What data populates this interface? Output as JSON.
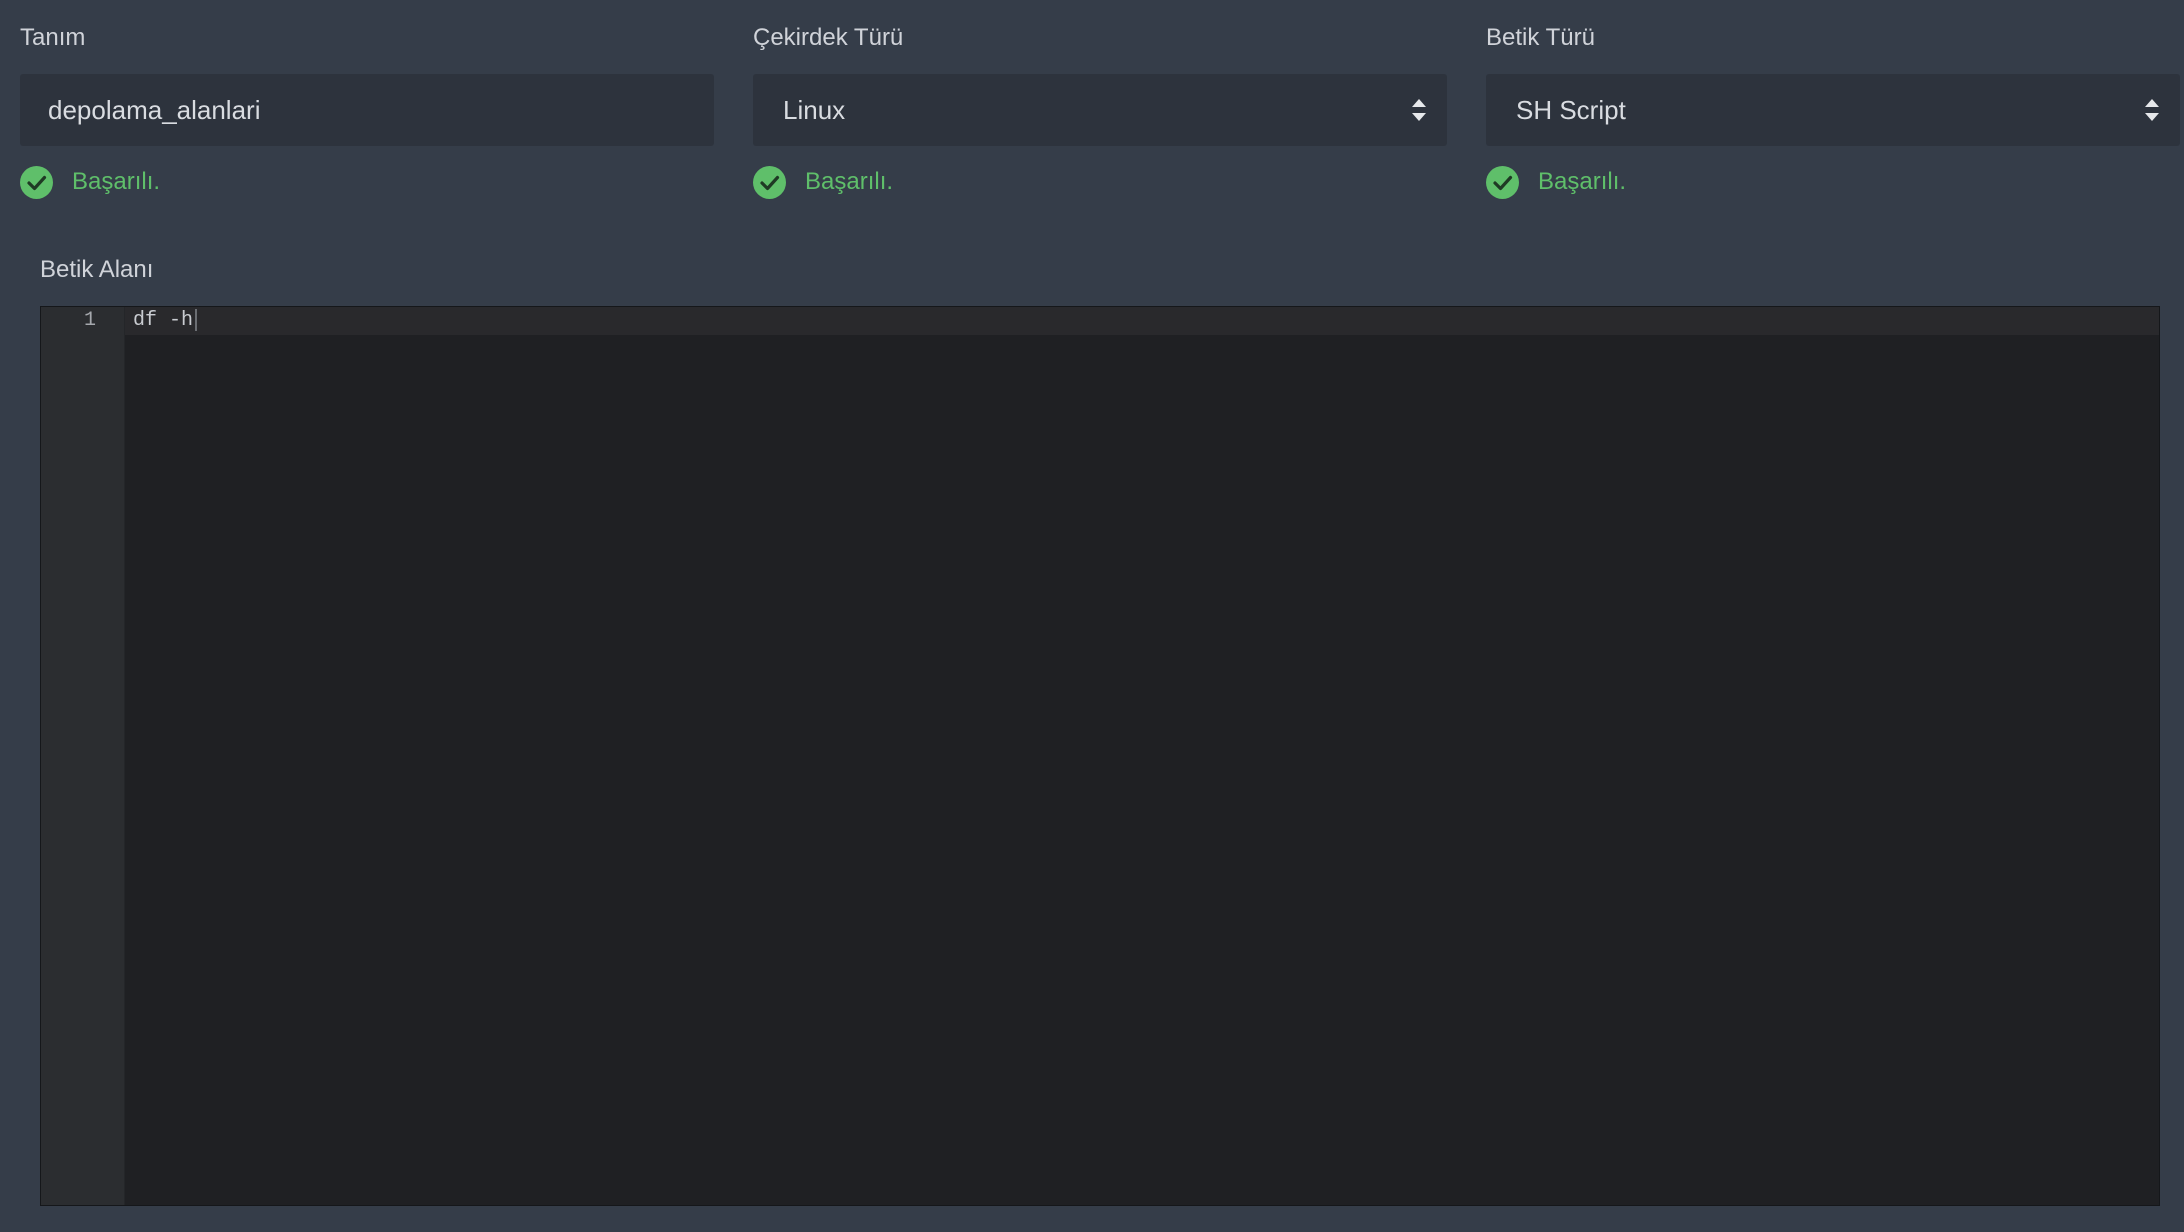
{
  "fields": [
    {
      "label": "Tanım",
      "value": "depolama_alanlari",
      "status": "Başarılı."
    },
    {
      "label": "Çekirdek Türü",
      "value": "Linux",
      "status": "Başarılı."
    },
    {
      "label": "Betik Türü",
      "value": "SH Script",
      "status": "Başarılı."
    }
  ],
  "editor": {
    "label": "Betik Alanı",
    "lines": [
      {
        "number": "1",
        "code": "df -h"
      }
    ]
  },
  "icons": {
    "status": "check-circle-icon",
    "select": "sort-arrows-icon"
  },
  "colors": {
    "background": "#353d49",
    "input_background": "#2d333d",
    "success": "#5fbf6a",
    "editor_background": "#1f2023",
    "gutter_background": "#2b2d30"
  }
}
